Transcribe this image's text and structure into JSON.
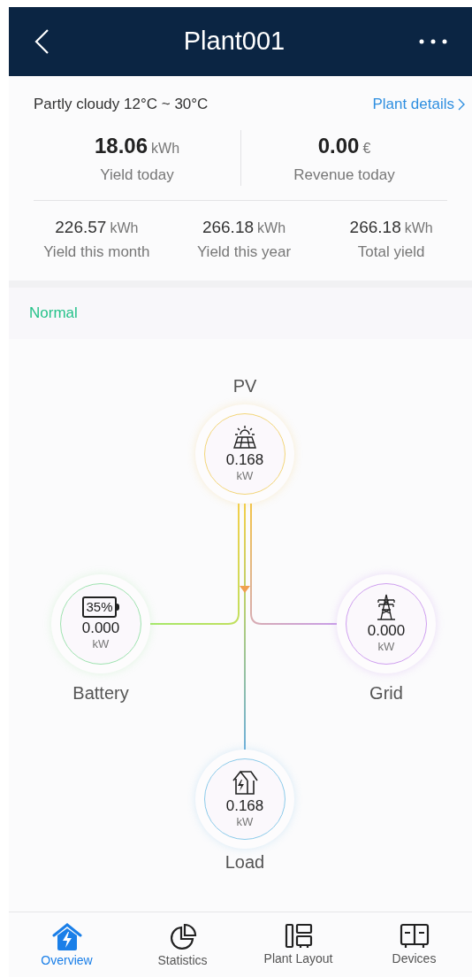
{
  "header": {
    "title": "Plant001"
  },
  "weather": "Partly cloudy 12°C ~ 30°C",
  "plant_details_link": "Plant details",
  "today": [
    {
      "value": "18.06",
      "unit": "kWh",
      "label": "Yield today"
    },
    {
      "value": "0.00",
      "unit": "€",
      "label": "Revenue today"
    }
  ],
  "totals": [
    {
      "value": "226.57",
      "unit": "kWh",
      "label": "Yield this month"
    },
    {
      "value": "266.18",
      "unit": "kWh",
      "label": "Yield this year"
    },
    {
      "value": "266.18",
      "unit": "kWh",
      "label": "Total yield"
    }
  ],
  "status": {
    "text": "Normal"
  },
  "flow": {
    "nodes": [
      {
        "kind": "pv",
        "name": "PV",
        "value": "0.168",
        "unit": "kW"
      },
      {
        "kind": "battery",
        "name": "Battery",
        "value": "0.000",
        "unit": "kW",
        "charge": "35%"
      },
      {
        "kind": "grid",
        "name": "Grid",
        "value": "0.000",
        "unit": "kW"
      },
      {
        "kind": "load",
        "name": "Load",
        "value": "0.168",
        "unit": "kW"
      }
    ]
  },
  "tabs": [
    {
      "kind": "overview",
      "label": "Overview",
      "selected": true
    },
    {
      "kind": "statistics",
      "label": "Statistics",
      "selected": false
    },
    {
      "kind": "layout",
      "label": "Plant Layout",
      "selected": false
    },
    {
      "kind": "devices",
      "label": "Devices",
      "selected": false
    }
  ]
}
